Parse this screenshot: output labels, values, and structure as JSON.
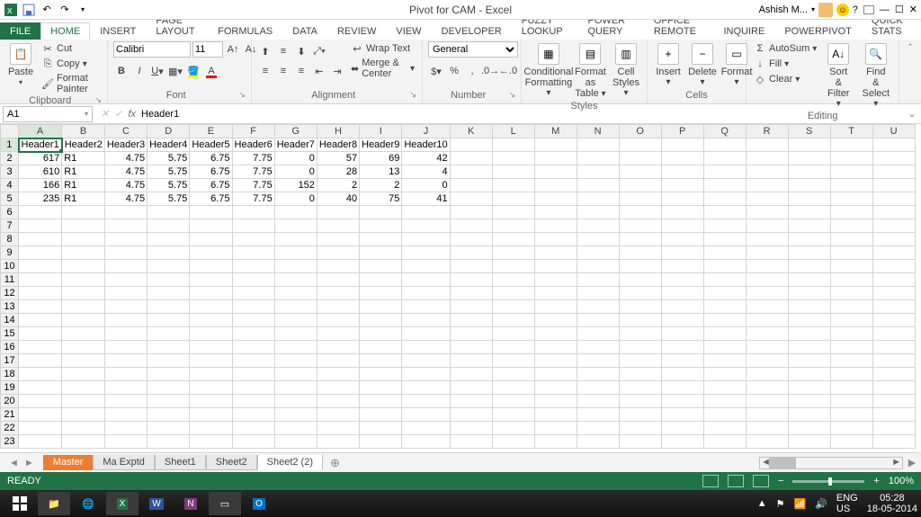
{
  "app": {
    "title": "Pivot for CAM - Excel",
    "user": "Ashish M..."
  },
  "ribbon_tabs": [
    "FILE",
    "HOME",
    "INSERT",
    "PAGE LAYOUT",
    "FORMULAS",
    "DATA",
    "REVIEW",
    "VIEW",
    "DEVELOPER",
    "Fuzzy Lookup",
    "POWER QUERY",
    "OFFICE REMOTE",
    "INQUIRE",
    "POWERPIVOT",
    "QUICK STATS"
  ],
  "ribbon": {
    "clipboard": {
      "paste": "Paste",
      "cut": "Cut",
      "copy": "Copy",
      "fp": "Format Painter",
      "label": "Clipboard"
    },
    "font": {
      "name": "Calibri",
      "size": "11",
      "label": "Font"
    },
    "alignment": {
      "wrap": "Wrap Text",
      "merge": "Merge & Center",
      "label": "Alignment"
    },
    "number": {
      "format": "General",
      "label": "Number"
    },
    "styles": {
      "cf": "Conditional Formatting",
      "ft": "Format as Table",
      "cs": "Cell Styles",
      "label": "Styles"
    },
    "cells": {
      "ins": "Insert",
      "del": "Delete",
      "fmt": "Format",
      "label": "Cells"
    },
    "editing": {
      "asum": "AutoSum",
      "fill": "Fill",
      "clear": "Clear",
      "sort": "Sort & Filter",
      "find": "Find & Select",
      "label": "Editing"
    }
  },
  "namebox": "A1",
  "formula": "Header1",
  "columns": [
    "A",
    "B",
    "C",
    "D",
    "E",
    "F",
    "G",
    "H",
    "I",
    "J",
    "K",
    "L",
    "M",
    "N",
    "O",
    "P",
    "Q",
    "R",
    "S",
    "T",
    "U"
  ],
  "rows": 23,
  "headers": [
    "Header1",
    "Header2",
    "Header3",
    "Header4",
    "Header5",
    "Header6",
    "Header7",
    "Header8",
    "Header9",
    "Header10"
  ],
  "data": [
    [
      617,
      "R1",
      4.75,
      5.75,
      6.75,
      7.75,
      0,
      57,
      69,
      42
    ],
    [
      610,
      "R1",
      4.75,
      5.75,
      6.75,
      7.75,
      0,
      28,
      13,
      4
    ],
    [
      166,
      "R1",
      4.75,
      5.75,
      6.75,
      7.75,
      152,
      2,
      2,
      0
    ],
    [
      235,
      "R1",
      4.75,
      5.75,
      6.75,
      7.75,
      0,
      40,
      75,
      41
    ]
  ],
  "sheets": [
    "Master",
    "Ma Exptd",
    "Sheet1",
    "Sheet2",
    "Sheet2 (2)"
  ],
  "active_sheet": 4,
  "status": {
    "mode": "READY",
    "zoom": "100%",
    "lang": "ENG",
    "kbd": "US",
    "time": "05:28",
    "date": "18-05-2014"
  }
}
